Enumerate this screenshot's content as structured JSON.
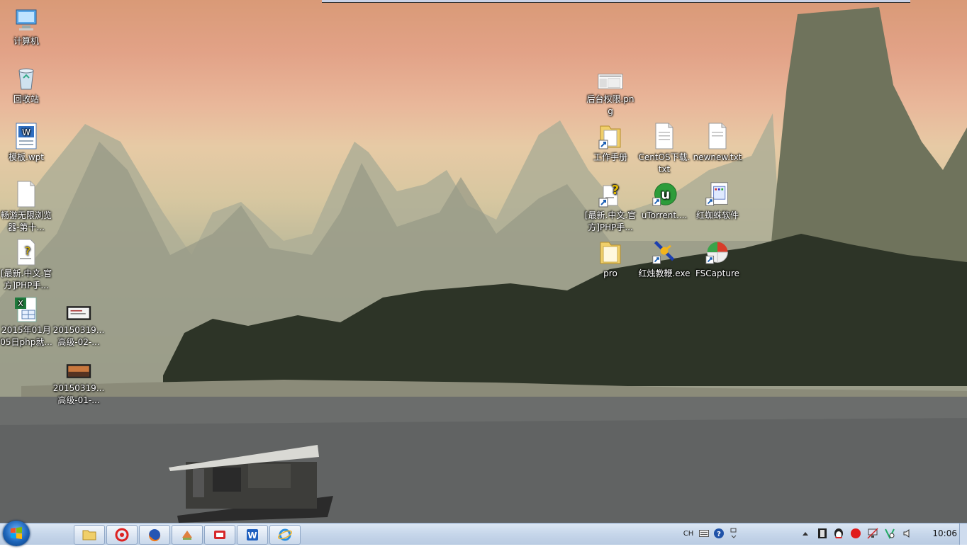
{
  "desktop": {
    "icons_left": [
      {
        "label": "计算机",
        "icon": "computer-icon"
      },
      {
        "label": "回收站",
        "icon": "recycle-bin-icon"
      },
      {
        "label": "模板.wpt",
        "icon": "wps-document-icon"
      },
      {
        "label": "畅游无限浏览器-第十...",
        "icon": "text-file-icon"
      },
      {
        "label": "[最新.中文.官方]PHP手...",
        "icon": "help-file-icon"
      },
      {
        "label": "2015年01月05日php就...",
        "icon": "excel-file-icon"
      },
      {
        "label": "20150319...高级-02-...",
        "icon": "video-file-icon"
      },
      {
        "label": "20150319...高级-01-...",
        "icon": "video-file-icon"
      }
    ],
    "icons_right": [
      {
        "label": "后台权限.png",
        "icon": "image-file-icon"
      },
      {
        "label": "工作手册",
        "icon": "folder-shortcut-icon"
      },
      {
        "label": "CentOS下载.txt",
        "icon": "text-file-icon"
      },
      {
        "label": "newnew.txt",
        "icon": "text-file-icon"
      },
      {
        "label": "[最新.中文.官方]PHP手...",
        "icon": "help-shortcut-icon"
      },
      {
        "label": "uTorrent....",
        "icon": "utorrent-icon"
      },
      {
        "label": "红蜘蛛软件",
        "icon": "red-spider-icon"
      },
      {
        "label": "pro",
        "icon": "folder-icon"
      },
      {
        "label": "红烛教鞭.exe",
        "icon": "pointer-app-icon"
      },
      {
        "label": "FSCapture",
        "icon": "fscapture-icon"
      }
    ]
  },
  "taskbar": {
    "pinned": [
      {
        "name": "explorer",
        "icon": "folder-icon"
      },
      {
        "name": "browser",
        "icon": "red-browser-icon"
      },
      {
        "name": "firefox",
        "icon": "firefox-icon"
      },
      {
        "name": "tool",
        "icon": "app-icon"
      },
      {
        "name": "recorder",
        "icon": "red-app-icon"
      },
      {
        "name": "wps",
        "icon": "wps-writer-icon"
      },
      {
        "name": "ie",
        "icon": "internet-explorer-icon"
      }
    ],
    "language": "CH",
    "clock": "10:06"
  },
  "colors": {
    "taskbar": "#c6d6ea",
    "sky_top": "#d99a77",
    "water": "#5a5c5c"
  }
}
